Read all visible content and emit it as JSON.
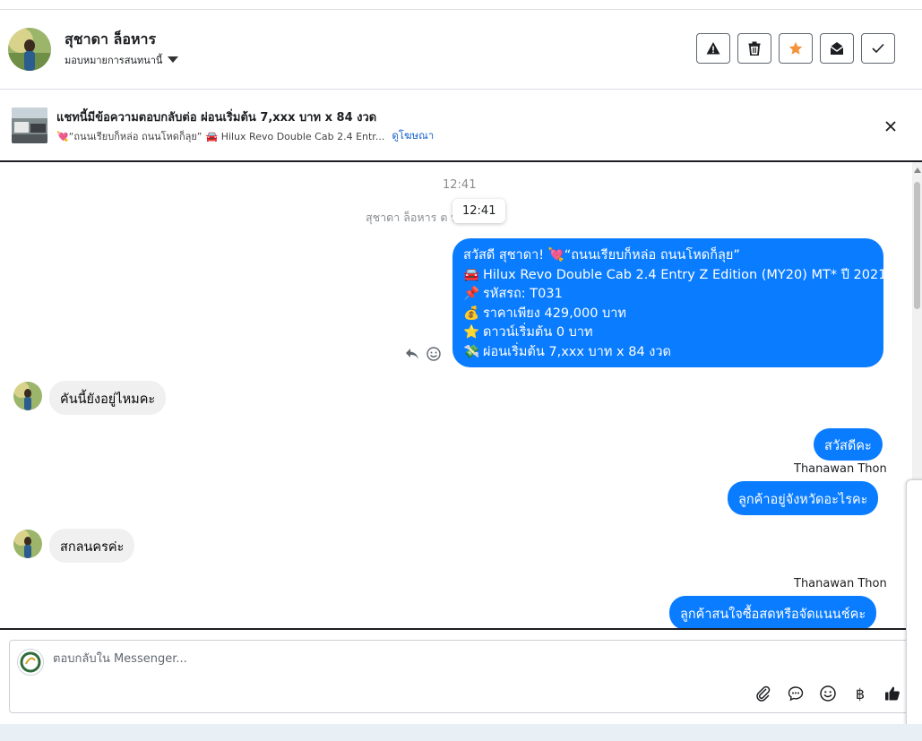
{
  "header": {
    "contact_name": "สุชาดา ล็อหาร",
    "assign_label": "มอบหมายการสนทนานี้",
    "actions": [
      {
        "name": "report-button",
        "icon": "warning-icon"
      },
      {
        "name": "delete-button",
        "icon": "trash-icon"
      },
      {
        "name": "star-button",
        "icon": "star-icon",
        "color": "#f5933b"
      },
      {
        "name": "mark-unread-button",
        "icon": "envelope-open-icon"
      },
      {
        "name": "done-button",
        "icon": "check-icon"
      }
    ]
  },
  "ad": {
    "title": "แชทนี้มีข้อความตอบกลับต่อ ผ่อนเริ่มต้น 7,xxx บาท x 84 งวด",
    "subtitle_prefix": "💘“ถนนเรียบก็หล่อ ถนนโหดก็ลุย”",
    "subtitle_car": "🚘 Hilux Revo Double Cab 2.4 Entr...",
    "link": "ดูโฆษณา"
  },
  "chat": {
    "timestamp": "12:41",
    "system_note": "สุชาดา ล็อหาร ต               ษณา",
    "tooltip": "12:41",
    "ad_message": {
      "line1": "สวัสดี สุชาดา! 💘“ถนนเรียบก็หล่อ ถนนโหดก็ลุย”",
      "line2": "Hilux Revo Double Cab 2.4 Entry Z Edition (MY20) MT* ปี 2021",
      "line3": "รหัสรถ: T031",
      "line4": "ราคาเพียง 429,000 บาท",
      "line5": "ดาวน์เริ่มต้น 0 บาท",
      "line6": "ผ่อนเริ่มต้น 7,xxx บาท x 84 งวด",
      "emoji2": "🚘",
      "emoji3": "📌",
      "emoji4": "💰",
      "emoji5": "⭐",
      "emoji6": "💸"
    },
    "messages": [
      {
        "dir": "in",
        "text": "คันนี้ยังอยู่ไหมคะ"
      },
      {
        "dir": "out",
        "text": "สวัสดีคะ"
      },
      {
        "dir": "out",
        "sender": "Thanawan Thon",
        "text": "ลูกค้าอยู่จังหวัดอะไรคะ"
      },
      {
        "dir": "in",
        "text": "สกลนครค่ะ"
      },
      {
        "dir": "out",
        "sender": "Thanawan Thon",
        "text": "ลูกค้าสนใจซื้อสดหรือจัดแนนช์คะ"
      }
    ]
  },
  "composer": {
    "placeholder": "ตอบกลับใน Messenger...",
    "tools": [
      "attach-icon",
      "saved-reply-icon",
      "emoji-icon",
      "baht-icon",
      "thumbs-up-icon"
    ],
    "baht_symbol": "฿"
  },
  "colors": {
    "accent": "#0a7cff",
    "link": "#1763cf"
  }
}
